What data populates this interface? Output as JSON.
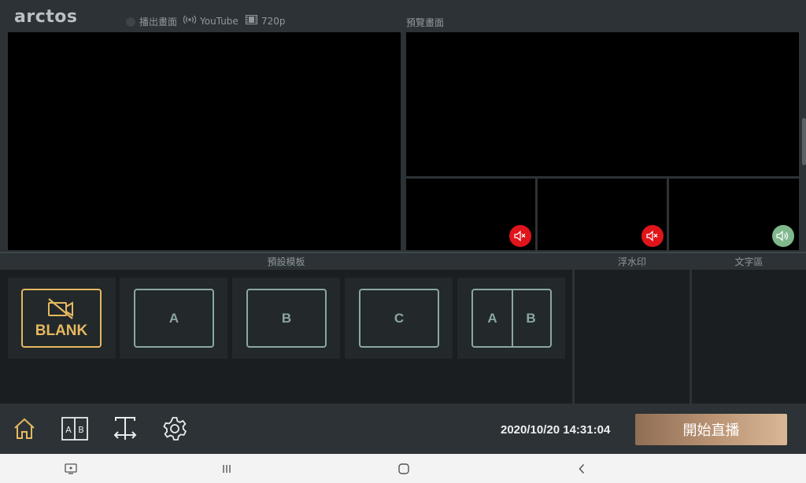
{
  "app": {
    "logo": "arctos"
  },
  "status": {
    "output_label": "播出畫面",
    "platform": "YouTube",
    "resolution": "720p"
  },
  "preview": {
    "label": "預覽畫面"
  },
  "audio_sources": [
    {
      "state": "muted",
      "color": "#e0141b"
    },
    {
      "state": "muted",
      "color": "#e0141b"
    },
    {
      "state": "active",
      "color": "#7fb88d"
    }
  ],
  "panels": {
    "templates_label": "預設模板",
    "watermark_label": "浮水印",
    "text_label": "文字區"
  },
  "templates": [
    {
      "label": "BLANK",
      "icon": "camera-off-icon",
      "selected": true
    },
    {
      "label": "A"
    },
    {
      "label": "B"
    },
    {
      "label": "C"
    },
    {
      "label_left": "A",
      "label_right": "B"
    }
  ],
  "toolbar": {
    "datetime": "2020/10/20 14:31:04",
    "golive_label": "開始直播",
    "icons": [
      "home-icon",
      "layout-ab-icon",
      "text-resize-icon",
      "gear-icon"
    ]
  },
  "colors": {
    "accent_gold": "#e5b960",
    "template_green": "#8aa79f",
    "mute_red": "#e0141b",
    "audio_green": "#7fb88d"
  }
}
